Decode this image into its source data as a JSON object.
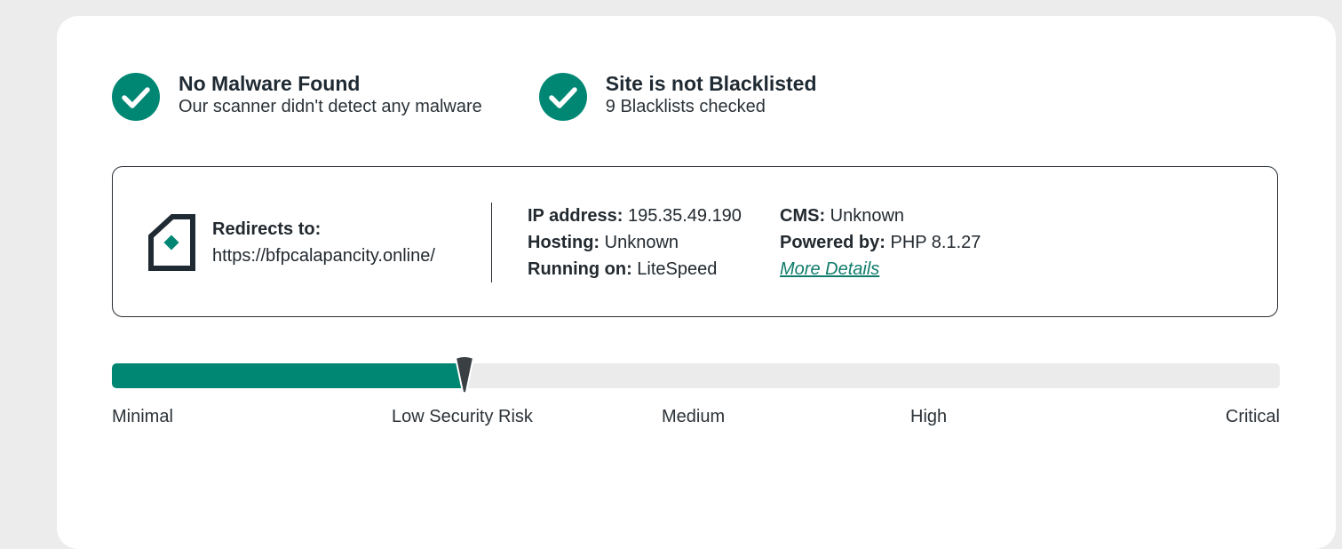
{
  "colors": {
    "accent": "#008774",
    "link": "#0f7c6b",
    "track": "#ebebeb",
    "text": "#22292f"
  },
  "status": [
    {
      "icon": "check-circle-icon",
      "title": "No Malware Found",
      "subtitle": "Our scanner didn't detect any malware"
    },
    {
      "icon": "check-circle-icon",
      "title": "Site is not Blacklisted",
      "subtitle": "9 Blacklists checked"
    }
  ],
  "site_info": {
    "icon": "site-page-icon",
    "redirect_label": "Redirects to:",
    "redirect_url": "https://bfpcalapancity.online/",
    "ip_label": "IP address:",
    "ip_value": "195.35.49.190",
    "hosting_label": "Hosting:",
    "hosting_value": "Unknown",
    "running_label": "Running on:",
    "running_value": "LiteSpeed",
    "cms_label": "CMS:",
    "cms_value": "Unknown",
    "powered_label": "Powered by:",
    "powered_value": "PHP 8.1.27",
    "more_details": "More Details"
  },
  "risk": {
    "level_fraction": 0.302,
    "labels": [
      "Minimal",
      "Low Security Risk",
      "Medium",
      "High",
      "Critical"
    ]
  }
}
